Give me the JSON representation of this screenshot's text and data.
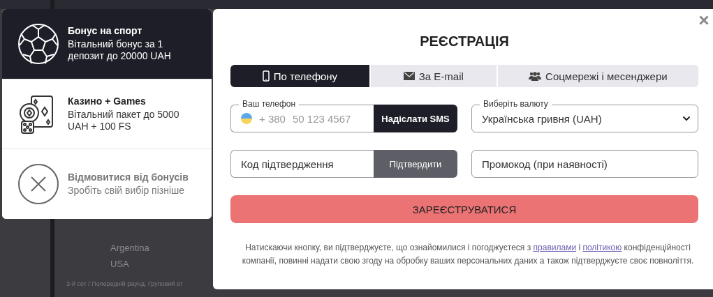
{
  "background": {
    "rows": [
      {
        "team": "Argentina"
      },
      {
        "team": "USA"
      }
    ],
    "caption": "3-й сет / Попередній раунд. Груповий ет"
  },
  "bonuses": [
    {
      "kind": "sport",
      "title": "Бонус на спорт",
      "description": "Вітальний бонус за 1 депозит до 20000 UAH",
      "selected": true
    },
    {
      "kind": "casino",
      "title": "Казино + Games",
      "description": "Вітальний пакет до 5000 UAH + 100 FS",
      "selected": false
    },
    {
      "kind": "decline",
      "title": "Відмовитися від бонусів",
      "description": "Зробіть свій вибір пізніше",
      "selected": false
    }
  ],
  "modal": {
    "title": "РЕЄСТРАЦІЯ",
    "tabs": [
      {
        "kind": "phone",
        "label": "По телефону",
        "selected": true
      },
      {
        "kind": "email",
        "label": "За E-mail",
        "selected": false
      },
      {
        "kind": "social",
        "label": "Соцмережі і месенджери",
        "selected": false
      }
    ],
    "phone": {
      "label": "Ваш телефон",
      "prefix": "+ 380",
      "placeholder": "50 123 4567",
      "button": "Надіслати SMS"
    },
    "currency": {
      "label": "Виберіть валюту",
      "value": "Українська гривня (UAH)"
    },
    "code": {
      "placeholder": "Код підтвердження",
      "button": "Підтвердити"
    },
    "promo": {
      "placeholder": "Промокод (при наявності)"
    },
    "submit": "ЗАРЕЄСТРУВАТИСЯ",
    "consent": [
      {
        "kind": "text",
        "text": "Натискаючи кнопку, ви підтверджуєте, що ознайомилися і погоджуєтеся з "
      },
      {
        "kind": "link",
        "text": "правилами"
      },
      {
        "kind": "text",
        "text": " і "
      },
      {
        "kind": "link",
        "text": "політикою"
      },
      {
        "kind": "text",
        "text": " конфіденційності компанії, повинні надати свою згоду на обробку ваших персональних даних а також підтверджуєте своє повноліття."
      }
    ]
  }
}
